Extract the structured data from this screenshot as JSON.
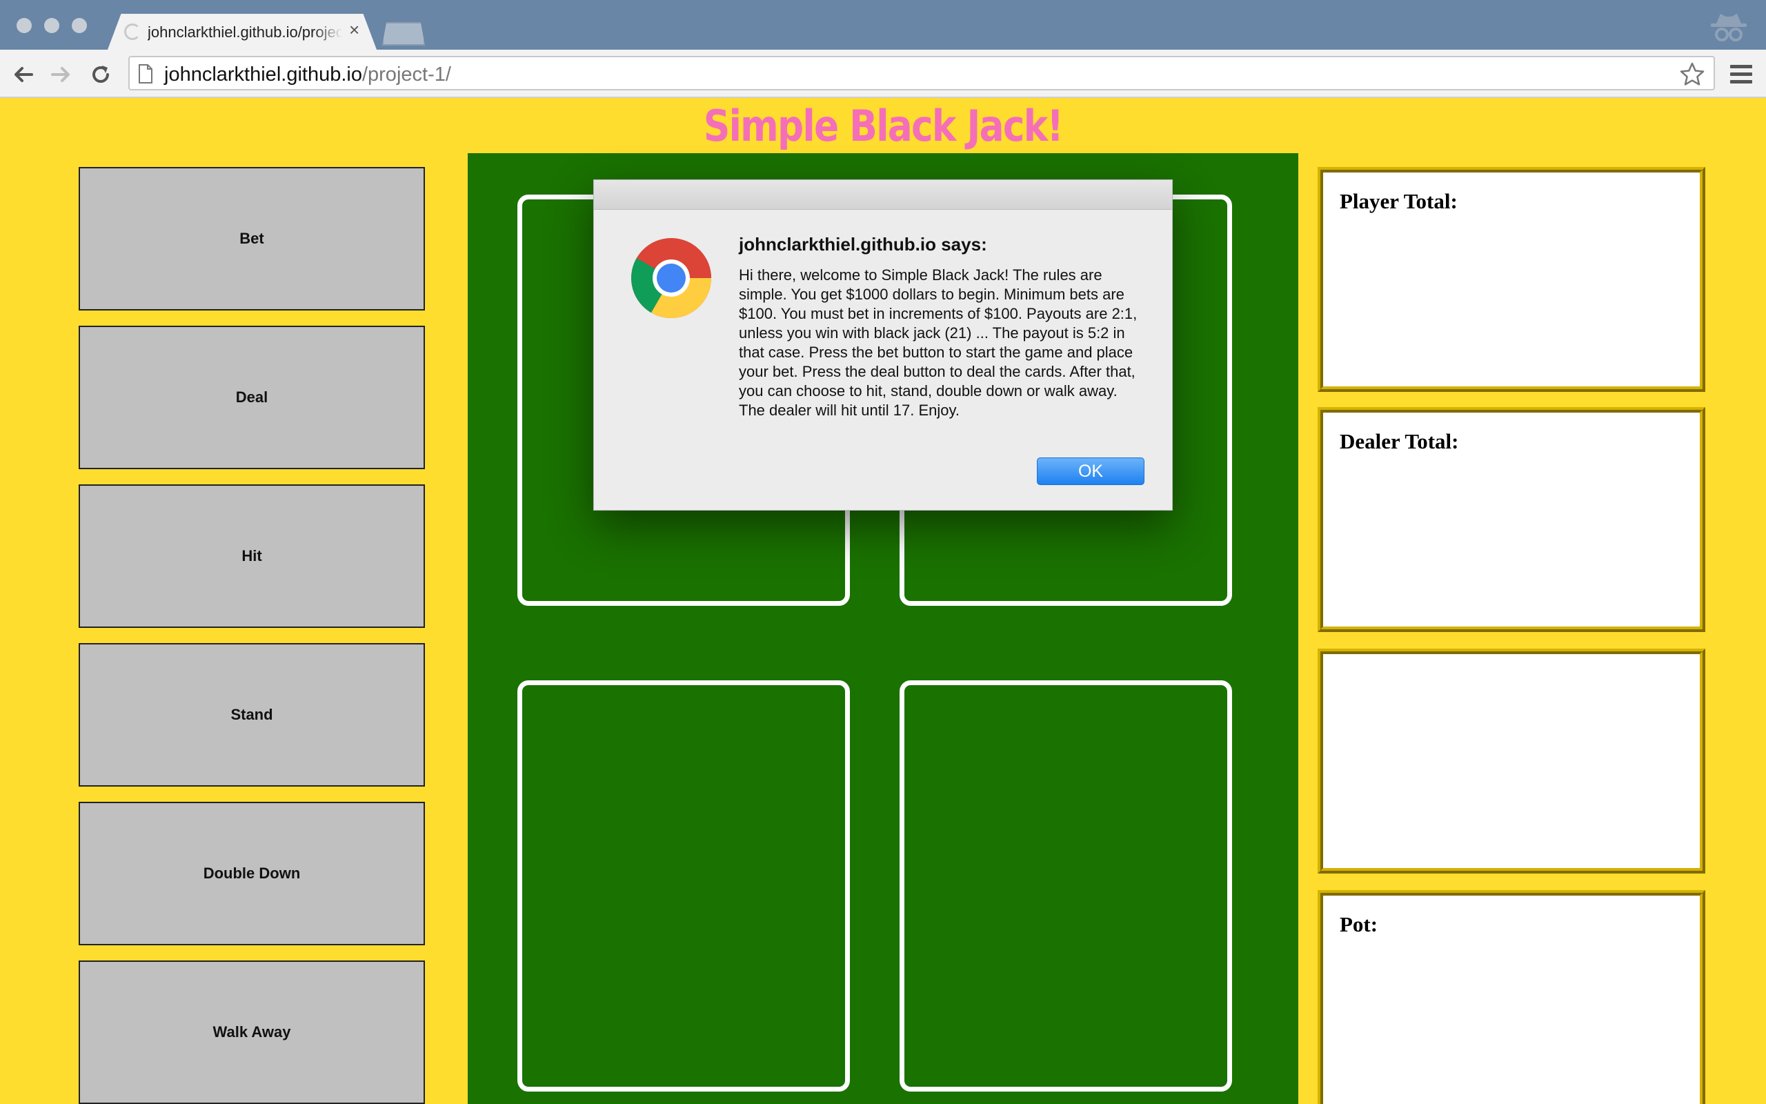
{
  "browser": {
    "tab_title": "johnclarkthiel.github.io/project-1/",
    "tab_close": "×",
    "url_host": "johnclarkthiel.github.io",
    "url_path": "/project-1/"
  },
  "page": {
    "title": "Simple Black Jack!"
  },
  "controls": {
    "bet": "Bet",
    "deal": "Deal",
    "hit": "Hit",
    "stand": "Stand",
    "double_down": "Double Down",
    "walk_away": "Walk Away"
  },
  "info": {
    "player_total": "Player Total:",
    "dealer_total": "Dealer Total:",
    "pot": "Pot:"
  },
  "dialog": {
    "heading": "johnclarkthiel.github.io says:",
    "message": "Hi there, welcome to Simple Black Jack! The rules are simple. You get $1000 dollars to begin. Minimum bets are $100. You must bet in increments of $100. Payouts are 2:1, unless you win with black jack (21) ... The payout is 5:2 in that case. Press the bet button to start the game and place your bet. Press the deal button to deal the cards. After that, you can choose to hit, stand, double down or walk away. The dealer will hit until 17. Enjoy.",
    "ok": "OK"
  },
  "colors": {
    "page_background": "#fedd2f",
    "title_pink": "#f46fb8",
    "table_green": "#1a7200",
    "button_gray": "#c0c0c0",
    "box_border": "#d4b200",
    "ok_blue": "#1f81f0"
  },
  "icons": [
    "back-arrow-icon",
    "forward-arrow-icon",
    "reload-icon",
    "page-icon",
    "star-icon",
    "menu-icon",
    "incognito-icon",
    "chrome-logo-icon",
    "loading-spinner-icon"
  ]
}
